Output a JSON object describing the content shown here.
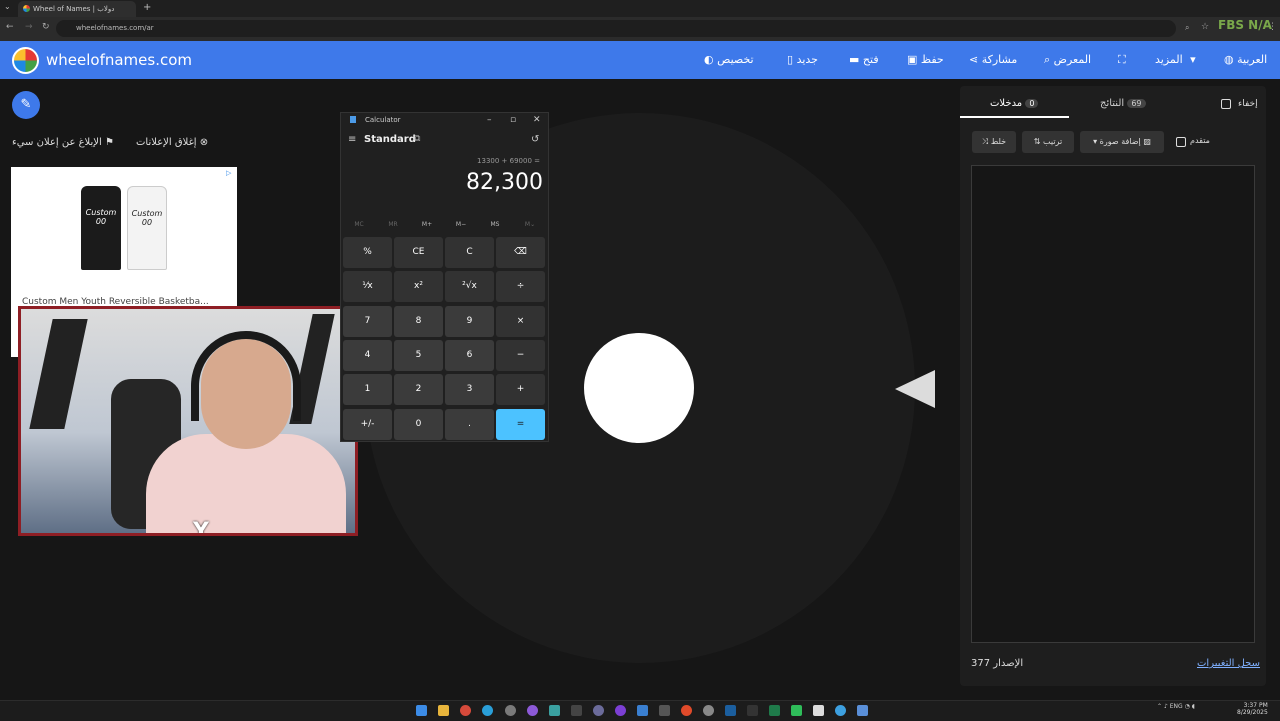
{
  "browser": {
    "tab_title": "Wheel of Names | دولاب عشوائي",
    "url": "wheelofnames.com/ar"
  },
  "overlay_text": "FBS N/A",
  "site": {
    "name": "wheelofnames.com",
    "nav": [
      "العربية",
      "المزيد",
      "المعرض",
      "مشاركة",
      "حفظ",
      "فتح",
      "جديد",
      "تخصيص"
    ],
    "accent": "#3e79ea"
  },
  "ads": {
    "close_label": "إغلاق الإعلانات",
    "report_label": "الإبلاغ عن إعلان سيء",
    "jersey_text": "Custom",
    "jersey_number": "00",
    "link_text": "Custom Men Youth Reversible Basketba..."
  },
  "calculator": {
    "title": "Calculator",
    "mode": "Standard",
    "expression": "13300 + 69000 =",
    "display": "82,300",
    "memory": [
      "MC",
      "MR",
      "M+",
      "M−",
      "MS",
      "M⌄"
    ],
    "keys": [
      [
        "%",
        "CE",
        "C",
        "⌫"
      ],
      [
        "⅟x",
        "x²",
        "²√x",
        "÷"
      ],
      [
        "7",
        "8",
        "9",
        "×"
      ],
      [
        "4",
        "5",
        "6",
        "−"
      ],
      [
        "1",
        "2",
        "3",
        "+"
      ],
      [
        "+/-",
        "0",
        ".",
        "="
      ]
    ]
  },
  "panel": {
    "entries_tab": "مدخلات",
    "entries_count": "0",
    "results_tab": "النتائج",
    "results_count": "69",
    "hide_label": "إخفاء",
    "shuffle_label": "خلط",
    "sort_label": "ترتيب",
    "add_image_label": "إضافة صورة",
    "advanced_label": "متقدم",
    "version_label": "الإصدار 377",
    "changelog_label": "سجل التغييرات"
  },
  "taskbar": {
    "language": "ENG",
    "time": "3:37 PM",
    "date": "8/29/2025"
  }
}
